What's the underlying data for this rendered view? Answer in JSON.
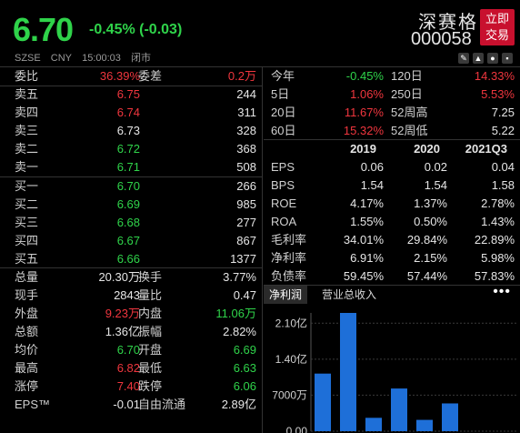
{
  "header": {
    "price": "6.70",
    "change": "-0.45% (-0.03)",
    "stock_name": "深赛格",
    "stock_code": "000058",
    "trade_button": [
      "立即",
      "交易"
    ]
  },
  "subheader": {
    "exchange": "SZSE",
    "currency": "CNY",
    "time": "15:00:03",
    "status": "闭市"
  },
  "order_book": {
    "ratio": {
      "label1": "委比",
      "value1": "36.39%",
      "label2": "委差",
      "value2": "0.2万"
    },
    "asks": [
      {
        "label": "卖五",
        "price": "6.75",
        "volume": "244"
      },
      {
        "label": "卖四",
        "price": "6.74",
        "volume": "311"
      },
      {
        "label": "卖三",
        "price": "6.73",
        "volume": "328"
      },
      {
        "label": "卖二",
        "price": "6.72",
        "volume": "368"
      },
      {
        "label": "卖一",
        "price": "6.71",
        "volume": "508"
      }
    ],
    "bids": [
      {
        "label": "买一",
        "price": "6.70",
        "volume": "266"
      },
      {
        "label": "买二",
        "price": "6.69",
        "volume": "985"
      },
      {
        "label": "买三",
        "price": "6.68",
        "volume": "277"
      },
      {
        "label": "买四",
        "price": "6.67",
        "volume": "867"
      },
      {
        "label": "买五",
        "price": "6.66",
        "volume": "1377"
      }
    ]
  },
  "stats": [
    {
      "l1": "总量",
      "v1": "20.30万",
      "l2": "换手",
      "v2": "3.77%"
    },
    {
      "l1": "现手",
      "v1": "2843",
      "l2": "量比",
      "v2": "0.47"
    },
    {
      "l1": "外盘",
      "v1": "9.23万",
      "l2": "内盘",
      "v2": "11.06万"
    },
    {
      "l1": "总额",
      "v1": "1.36亿",
      "l2": "振幅",
      "v2": "2.82%"
    },
    {
      "l1": "均价",
      "v1": "6.70",
      "l2": "开盘",
      "v2": "6.69"
    },
    {
      "l1": "最高",
      "v1": "6.82",
      "l2": "最低",
      "v2": "6.63"
    },
    {
      "l1": "涨停",
      "v1": "7.40",
      "l2": "跌停",
      "v2": "6.06"
    },
    {
      "l1": "EPS™",
      "v1": "-0.01",
      "l2": "自由流通",
      "v2": "2.89亿"
    }
  ],
  "performance": [
    {
      "l1": "今年",
      "v1": "-0.45%",
      "l2": "120日",
      "v2": "14.33%"
    },
    {
      "l1": "5日",
      "v1": "1.06%",
      "l2": "250日",
      "v2": "5.53%"
    },
    {
      "l1": "20日",
      "v1": "11.67%",
      "l2": "52周高",
      "v2": "7.25"
    },
    {
      "l1": "60日",
      "v1": "15.32%",
      "l2": "52周低",
      "v2": "5.22"
    }
  ],
  "financials": {
    "years": [
      "2019",
      "2020",
      "2021Q3"
    ],
    "rows": [
      {
        "label": "EPS",
        "values": [
          "0.06",
          "0.02",
          "0.04"
        ]
      },
      {
        "label": "BPS",
        "values": [
          "1.54",
          "1.54",
          "1.58"
        ]
      },
      {
        "label": "ROE",
        "values": [
          "4.17%",
          "1.37%",
          "2.78%"
        ]
      },
      {
        "label": "ROA",
        "values": [
          "1.55%",
          "0.50%",
          "1.43%"
        ]
      },
      {
        "label": "毛利率",
        "values": [
          "34.01%",
          "29.84%",
          "22.89%"
        ]
      },
      {
        "label": "净利率",
        "values": [
          "6.91%",
          "2.15%",
          "5.98%"
        ]
      },
      {
        "label": "负债率",
        "values": [
          "59.45%",
          "57.44%",
          "57.83%"
        ]
      }
    ]
  },
  "tabs": {
    "active": "净利润",
    "other": "营业总收入",
    "more": "•••"
  },
  "chart_data": {
    "type": "bar",
    "categories": [
      "",
      "",
      "",
      "",
      "",
      ""
    ],
    "values": [
      1.12,
      2.3,
      0.26,
      0.83,
      0.22,
      0.54
    ],
    "unit": "亿",
    "ylim": [
      0,
      2.3
    ],
    "ticks": [
      {
        "value": 2.1,
        "label": "2.10亿"
      },
      {
        "value": 1.4,
        "label": "1.40亿"
      },
      {
        "value": 0.7,
        "label": "7000万"
      },
      {
        "value": 0.0,
        "label": "0.00"
      }
    ],
    "color": "#1e6fd8"
  },
  "colors": {
    "up": "#f0363e",
    "down": "#2fd34a",
    "bar": "#1e6fd8",
    "trade_button": "#c8102e"
  }
}
